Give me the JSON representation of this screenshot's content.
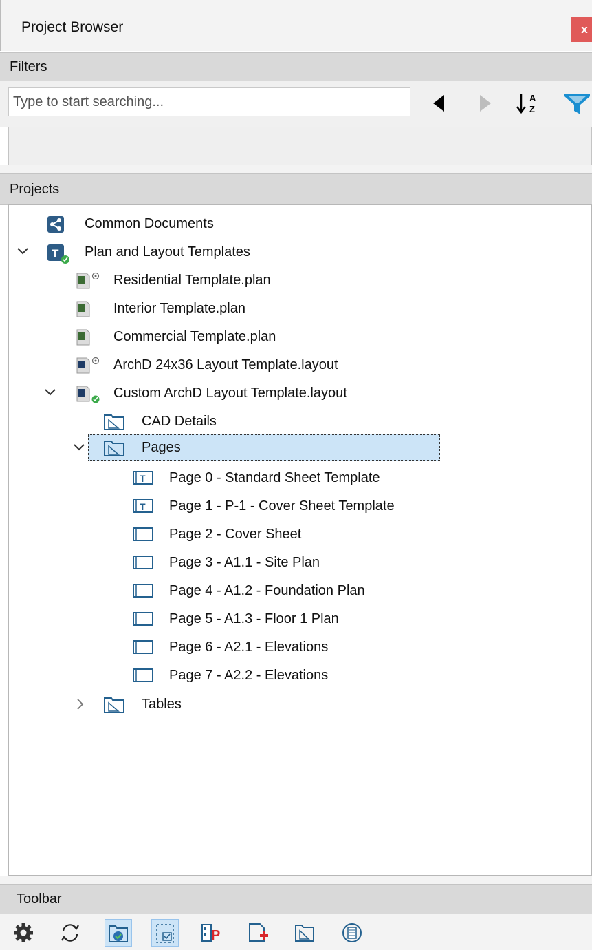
{
  "window": {
    "title": "Project Browser",
    "close_label": "x"
  },
  "filters": {
    "header": "Filters",
    "search_placeholder": "Type to start searching..."
  },
  "projects": {
    "header": "Projects",
    "tree": {
      "common_documents": "Common Documents",
      "plan_and_layout_templates": "Plan and Layout Templates",
      "residential_template": "Residential Template.plan",
      "interior_template": "Interior Template.plan",
      "commercial_template": "Commercial Template.plan",
      "archd_24x36_layout": "ArchD 24x36 Layout Template.layout",
      "custom_archd_layout": "Custom ArchD Layout Template.layout",
      "cad_details": "CAD Details",
      "pages": "Pages",
      "page_items": [
        "Page 0 - Standard Sheet Template",
        "Page 1 - P-1 - Cover Sheet Template",
        "Page 2 - Cover Sheet",
        "Page 3 - A1.1 - Site Plan",
        "Page 4 - A1.2 - Foundation Plan",
        "Page 5 - A1.3 - Floor 1 Plan",
        "Page 6 - A2.1 - Elevations",
        "Page 7 - A2.2 - Elevations"
      ],
      "tables": "Tables"
    }
  },
  "toolbar": {
    "header": "Toolbar"
  },
  "colors": {
    "accent_blue": "#1a8fd1",
    "selection": "#cce4f7",
    "close_red": "#e05a59",
    "header_gray": "#d9d9d9"
  }
}
